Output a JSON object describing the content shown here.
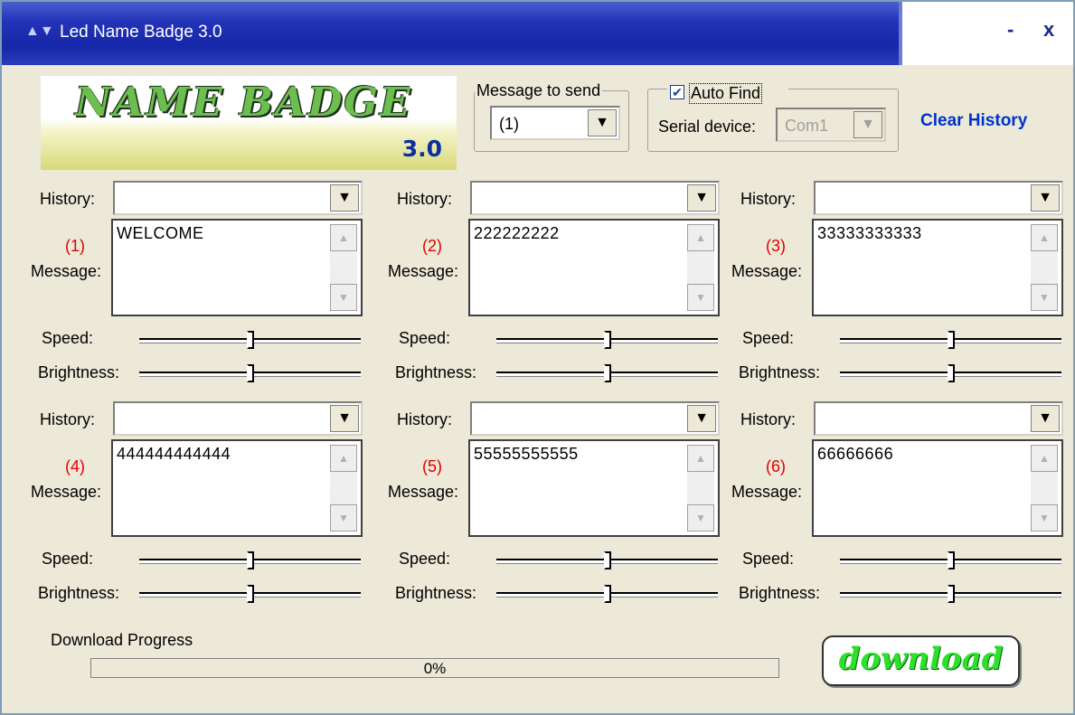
{
  "window": {
    "title": "Led Name Badge 3.0",
    "minimize_label": "-",
    "close_label": "x"
  },
  "logo": {
    "title": "NAME BADGE",
    "version": "3.0"
  },
  "message_to_send": {
    "legend": "Message to send",
    "value": "(1)"
  },
  "serial": {
    "auto_find_label": "Auto Find",
    "auto_find_checked": true,
    "device_label": "Serial device:",
    "device_value": "Com1"
  },
  "clear_history_label": "Clear History",
  "labels": {
    "history": "History:",
    "message": "Message:",
    "speed": "Speed:",
    "brightness": "Brightness:"
  },
  "messages": [
    {
      "number": "(1)",
      "history": "",
      "text": "WELCOME",
      "speed": 0.5,
      "brightness": 0.5
    },
    {
      "number": "(2)",
      "history": "",
      "text": "222222222",
      "speed": 0.5,
      "brightness": 0.5
    },
    {
      "number": "(3)",
      "history": "",
      "text": "33333333333",
      "speed": 0.5,
      "brightness": 0.5
    },
    {
      "number": "(4)",
      "history": "",
      "text": "444444444444",
      "speed": 0.5,
      "brightness": 0.5
    },
    {
      "number": "(5)",
      "history": "",
      "text": "55555555555",
      "speed": 0.5,
      "brightness": 0.5
    },
    {
      "number": "(6)",
      "history": "",
      "text": "66666666",
      "speed": 0.5,
      "brightness": 0.5
    }
  ],
  "download_progress": {
    "label": "Download Progress",
    "percent_text": "0%",
    "value": 0
  },
  "download_button_label": "download"
}
